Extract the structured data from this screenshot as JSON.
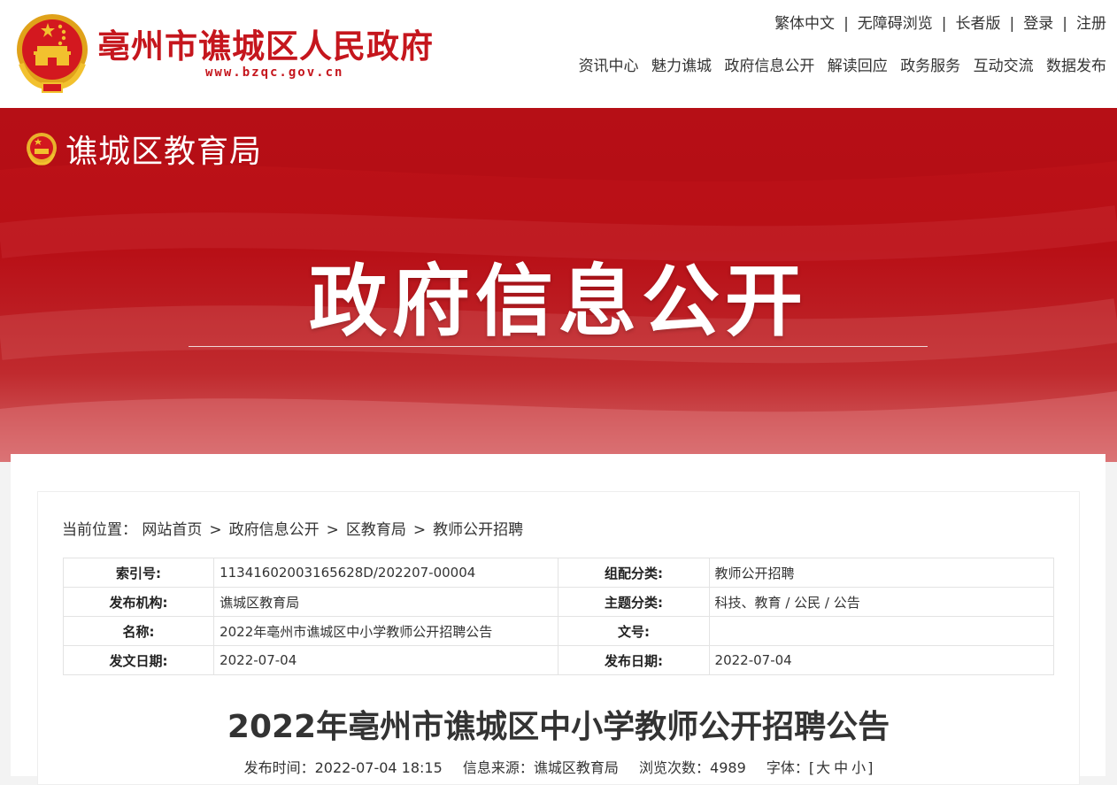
{
  "header": {
    "site_name": "亳州市谯城区人民政府",
    "site_url": "www.bzqc.gov.cn",
    "utility": [
      "繁体中文",
      "无障碍浏览",
      "长者版",
      "登录",
      "注册"
    ],
    "utility_separator": "|",
    "nav": [
      "资讯中心",
      "魅力谯城",
      "政府信息公开",
      "解读回应",
      "政务服务",
      "互动交流",
      "数据发布"
    ]
  },
  "banner": {
    "dept_name": "谯城区教育局",
    "title": "政府信息公开"
  },
  "breadcrumb": {
    "label": "当前位置：",
    "items": [
      "网站首页",
      "政府信息公开",
      "区教育局",
      "教师公开招聘"
    ],
    "separator": ">"
  },
  "meta": {
    "rows": [
      {
        "k1": "索引号:",
        "v1": "11341602003165628D/202207-00004",
        "k2": "组配分类:",
        "v2": "教师公开招聘"
      },
      {
        "k1": "发布机构:",
        "v1": "谯城区教育局",
        "k2": "主题分类:",
        "v2": "科技、教育 / 公民 / 公告"
      },
      {
        "k1": "名称:",
        "v1": "2022年亳州市谯城区中小学教师公开招聘公告",
        "k2": "文号:",
        "v2": ""
      },
      {
        "k1": "发文日期:",
        "v1": "2022-07-04",
        "k2": "发布日期:",
        "v2": "2022-07-04"
      }
    ]
  },
  "article": {
    "title": "2022年亳州市谯城区中小学教师公开招聘公告",
    "publish_label": "发布时间：",
    "publish_time": "2022-07-04 18:15",
    "source_label": "信息来源：",
    "source": "谯城区教育局",
    "views_label": "浏览次数：",
    "views": "4989",
    "font_label": "字体：",
    "font_open": "[",
    "font_large": "大",
    "font_medium": "中",
    "font_small": "小",
    "font_close": "]"
  },
  "colors": {
    "brand_red": "#c5161d",
    "banner_red": "#b80f16"
  }
}
